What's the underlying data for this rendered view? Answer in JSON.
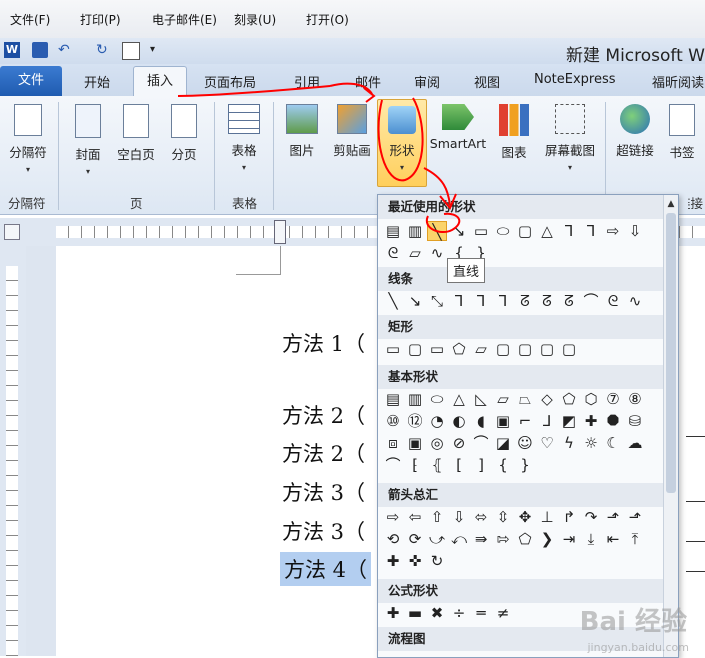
{
  "menubar": {
    "items": [
      "文件(F)",
      "打印(P)",
      "电子邮件(E)",
      "刻录(U)",
      "打开(O)"
    ]
  },
  "window": {
    "title": "新建 Microsoft W"
  },
  "tabs": {
    "file": "文件",
    "items": [
      "开始",
      "插入",
      "页面布局",
      "引用",
      "邮件",
      "审阅",
      "视图",
      "NoteExpress",
      "福昕阅读"
    ]
  },
  "ribbon": {
    "buttons": [
      "分隔符",
      "封面",
      "空白页",
      "分页",
      "表格",
      "图片",
      "剪贴画",
      "形状",
      "SmartArt",
      "图表",
      "屏幕截图",
      "超链接",
      "书签"
    ],
    "groups": [
      "分隔符",
      "页",
      "表格",
      "链接"
    ]
  },
  "shapes_panel": {
    "sections": [
      "最近使用的形状",
      "线条",
      "矩形",
      "基本形状",
      "箭头总汇",
      "公式形状",
      "流程图"
    ],
    "tooltip": "直线"
  },
  "document": {
    "lines": [
      "方法 1（",
      "方法 2（",
      "方法 2（",
      "方法 3（",
      "方法 3（",
      "方法 4（"
    ]
  },
  "watermark": {
    "brand": "Bai 经验",
    "url": "jingyan.baidu.com"
  },
  "colors": {
    "file_tab": "#1f5bb0",
    "annotation": "#ff0000",
    "selection": "#b3cef0"
  }
}
